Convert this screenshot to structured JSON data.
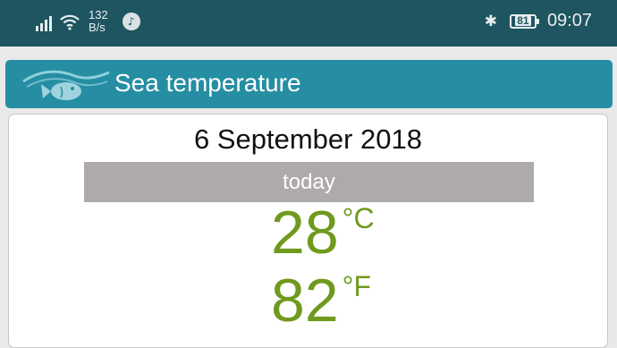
{
  "status_bar": {
    "network_speed_value": "132",
    "network_speed_unit": "B/s",
    "battery_level": "81",
    "time": "09:07",
    "icons": [
      "signal-icon",
      "wifi-icon",
      "music-icon",
      "bluetooth-icon",
      "battery-icon"
    ]
  },
  "app_bar": {
    "title": "Sea temperature",
    "logo_icon": "fish-wave-logo",
    "color": "#268ea3"
  },
  "forecast": {
    "date": "6 September 2018",
    "day_label": "today",
    "temp_celsius": "28",
    "celsius_unit": "°C",
    "temp_fahrenheit": "82",
    "fahrenheit_unit": "°F",
    "temp_color": "#6f9a1d"
  }
}
